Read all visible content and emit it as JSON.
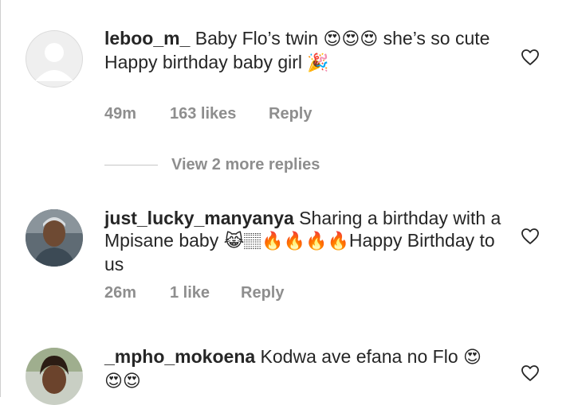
{
  "comments": [
    {
      "username": "leboo_m_",
      "text_a": " Baby Flo’s twin ",
      "emoji_a": "😍😍😍",
      "text_b": " she’s so cute",
      "line2": "Happy birthday baby girl ",
      "emoji_b": "🎉",
      "time": "49m",
      "likes": "163 likes",
      "reply": "Reply"
    },
    {
      "username": "just_lucky_manyanya",
      "text_a": " Sharing a birthday with a Mpisane baby ",
      "emoji_a": "😹🏽🔥🔥🔥🔥",
      "text_b": "Happy Birthday to us",
      "time": "26m",
      "likes": "1 like",
      "reply": "Reply"
    },
    {
      "username": "_mpho_mokoena",
      "text_a": " Kodwa ave efana no Flo ",
      "emoji_a": "😍",
      "emoji_b": "😍😍"
    }
  ],
  "view_replies": "View 2 more replies",
  "colors": {
    "meta": "#8e8e8e",
    "text": "#262626",
    "skin": "#8b5a3c"
  }
}
